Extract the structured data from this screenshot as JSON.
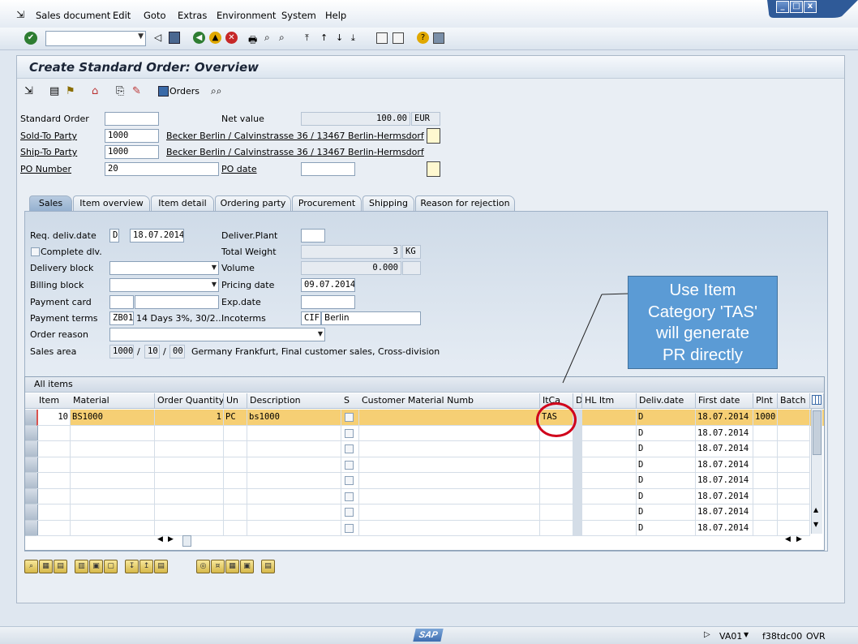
{
  "menu": {
    "items": [
      "Sales document",
      "Edit",
      "Goto",
      "Extras",
      "Environment",
      "System",
      "Help"
    ]
  },
  "window_controls": {
    "minimize": "_",
    "maximize": "□",
    "close": "x"
  },
  "toolbar": {
    "command_field_value": ""
  },
  "title": "Create Standard Order: Overview",
  "app_toolbar": {
    "orders_label": "Orders"
  },
  "header": {
    "standard_order_label": "Standard Order",
    "standard_order_value": "",
    "net_value_label": "Net value",
    "net_value": "100.00",
    "currency": "EUR",
    "sold_to_label": "Sold-To Party",
    "sold_to_value": "1000",
    "sold_to_text": "Becker Berlin / Calvinstrasse 36 / 13467 Berlin-Hermsdorf",
    "ship_to_label": "Ship-To Party",
    "ship_to_value": "1000",
    "ship_to_text": "Becker Berlin / Calvinstrasse 36 / 13467 Berlin-Hermsdorf",
    "po_number_label": "PO Number",
    "po_number_value": "20",
    "po_date_label": "PO date",
    "po_date_value": ""
  },
  "tabs": [
    "Sales",
    "Item overview",
    "Item detail",
    "Ordering party",
    "Procurement",
    "Shipping",
    "Reason for rejection"
  ],
  "sales_tab": {
    "req_deliv_date_label": "Req. deliv.date",
    "req_deliv_date_format": "D",
    "req_deliv_date_value": "18.07.2014",
    "deliver_plant_label": "Deliver.Plant",
    "deliver_plant_value": "",
    "complete_dlv_label": "Complete dlv.",
    "total_weight_label": "Total Weight",
    "total_weight_value": "3",
    "total_weight_unit": "KG",
    "delivery_block_label": "Delivery block",
    "volume_label": "Volume",
    "volume_value": "0.000",
    "billing_block_label": "Billing block",
    "pricing_date_label": "Pricing date",
    "pricing_date_value": "09.07.2014",
    "payment_card_label": "Payment card",
    "exp_date_label": "Exp.date",
    "payment_terms_label": "Payment terms",
    "payment_terms_code": "ZB01",
    "payment_terms_text": "14 Days 3%, 30/2...",
    "incoterms_label": "Incoterms",
    "incoterms_code": "CIF",
    "incoterms_place": "Berlin",
    "order_reason_label": "Order reason",
    "sales_area_label": "Sales area",
    "sales_org": "1000",
    "sep1": "/",
    "distr_channel": "10",
    "sep2": "/",
    "division": "00",
    "sales_area_text": "Germany Frankfurt, Final customer sales, Cross-division"
  },
  "callout": {
    "line1": "Use Item",
    "line2": "Category 'TAS'",
    "line3": "will generate",
    "line4": "PR directly"
  },
  "grid": {
    "title": "All items",
    "columns": [
      "Item",
      "Material",
      "Order Quantity",
      "Un",
      "Description",
      "S",
      "Customer Material Numb",
      "ItCa",
      "D",
      "HL Itm",
      "Deliv.date",
      "First date",
      "Plnt",
      "Batch"
    ],
    "rows": [
      {
        "item": "10",
        "material": "BS1000",
        "qty": "1",
        "un": "PC",
        "desc": "bs1000",
        "itca": "TAS",
        "d": "D",
        "first_date": "18.07.2014",
        "plnt": "1000"
      },
      {
        "item": "",
        "material": "",
        "qty": "",
        "un": "",
        "desc": "",
        "itca": "",
        "d": "D",
        "first_date": "18.07.2014",
        "plnt": ""
      },
      {
        "item": "",
        "material": "",
        "qty": "",
        "un": "",
        "desc": "",
        "itca": "",
        "d": "D",
        "first_date": "18.07.2014",
        "plnt": ""
      },
      {
        "item": "",
        "material": "",
        "qty": "",
        "un": "",
        "desc": "",
        "itca": "",
        "d": "D",
        "first_date": "18.07.2014",
        "plnt": ""
      },
      {
        "item": "",
        "material": "",
        "qty": "",
        "un": "",
        "desc": "",
        "itca": "",
        "d": "D",
        "first_date": "18.07.2014",
        "plnt": ""
      },
      {
        "item": "",
        "material": "",
        "qty": "",
        "un": "",
        "desc": "",
        "itca": "",
        "d": "D",
        "first_date": "18.07.2014",
        "plnt": ""
      },
      {
        "item": "",
        "material": "",
        "qty": "",
        "un": "",
        "desc": "",
        "itca": "",
        "d": "D",
        "first_date": "18.07.2014",
        "plnt": ""
      },
      {
        "item": "",
        "material": "",
        "qty": "",
        "un": "",
        "desc": "",
        "itca": "",
        "d": "D",
        "first_date": "18.07.2014",
        "plnt": ""
      }
    ]
  },
  "statusbar": {
    "logo": "SAP",
    "transaction": "VA01",
    "server": "f38tdc00",
    "mode": "OVR"
  },
  "colors": {
    "callout_fill": "#5b9bd5",
    "highlight_row": "#f6cf74",
    "circle": "#d0021b"
  }
}
